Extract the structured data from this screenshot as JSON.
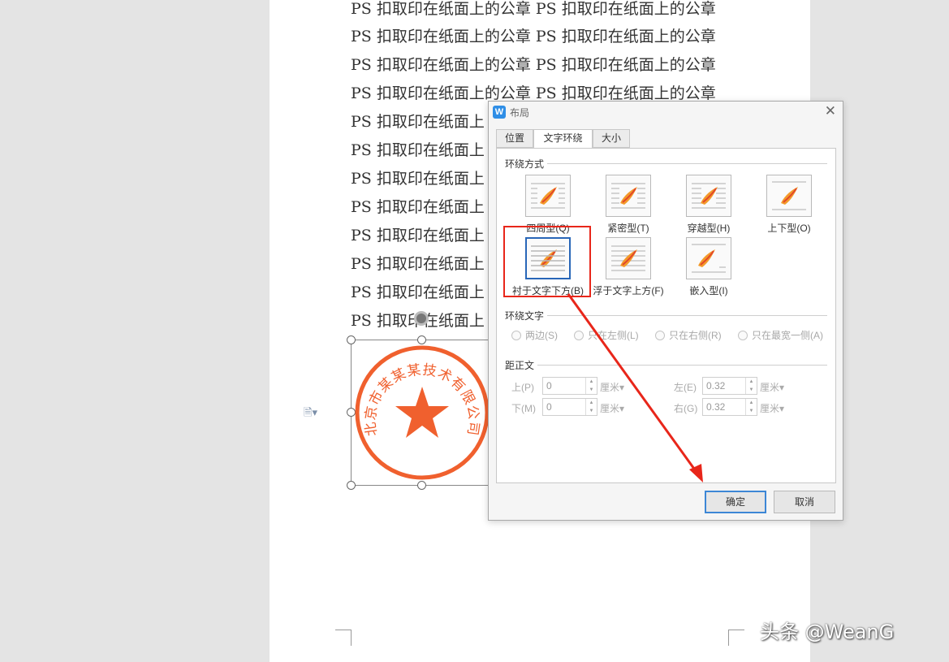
{
  "document": {
    "lines": [
      "PS 扣取印在纸面上的公章 PS 扣取印在纸面上的公章",
      "PS 扣取印在纸面上的公章 PS 扣取印在纸面上的公章",
      "PS 扣取印在纸面上的公章 PS 扣取印在纸面上的公章",
      "PS 扣取印在纸面上的公章 PS 扣取印在纸面上的公章",
      "PS 扣取印在纸面上",
      "PS 扣取印在纸面上",
      "PS 扣取印在纸面上",
      "PS 扣取印在纸面上",
      "PS 扣取印在纸面上",
      "PS 扣取印在纸面上",
      "PS 扣取印在纸面上",
      "PS 扣取印在纸面上"
    ],
    "seal_text": "北京市某某某技术有限公司",
    "seal_color": "#f0602e",
    "side_icon": "document-icon"
  },
  "dialog": {
    "app_icon": "W",
    "title": "布局",
    "tabs": [
      {
        "label": "位置",
        "active": false
      },
      {
        "label": "文字环绕",
        "active": true
      },
      {
        "label": "大小",
        "active": false
      }
    ],
    "wrap_style": {
      "section_title": "环绕方式",
      "options": [
        {
          "label": "四周型(Q)",
          "selected": false
        },
        {
          "label": "紧密型(T)",
          "selected": false
        },
        {
          "label": "穿越型(H)",
          "selected": false
        },
        {
          "label": "上下型(O)",
          "selected": false
        },
        {
          "label": "衬于文字下方(B)",
          "selected": true
        },
        {
          "label": "浮于文字上方(F)",
          "selected": false
        },
        {
          "label": "嵌入型(I)",
          "selected": false
        }
      ]
    },
    "wrap_text": {
      "section_title": "环绕文字",
      "options": [
        "两边(S)",
        "只在左侧(L)",
        "只在右侧(R)",
        "只在最宽一侧(A)"
      ]
    },
    "distance": {
      "section_title": "距正文",
      "top": {
        "label": "上(P)",
        "value": "0",
        "unit": "厘米"
      },
      "bottom": {
        "label": "下(M)",
        "value": "0",
        "unit": "厘米"
      },
      "left": {
        "label": "左(E)",
        "value": "0.32",
        "unit": "厘米"
      },
      "right": {
        "label": "右(G)",
        "value": "0.32",
        "unit": "厘米"
      }
    },
    "ok_label": "确定",
    "cancel_label": "取消"
  },
  "watermark": "头条 @WeanG",
  "colors": {
    "annotation_red": "#e8261a",
    "selected_border": "#2866b8",
    "primary_button_border": "#3d87d6"
  }
}
